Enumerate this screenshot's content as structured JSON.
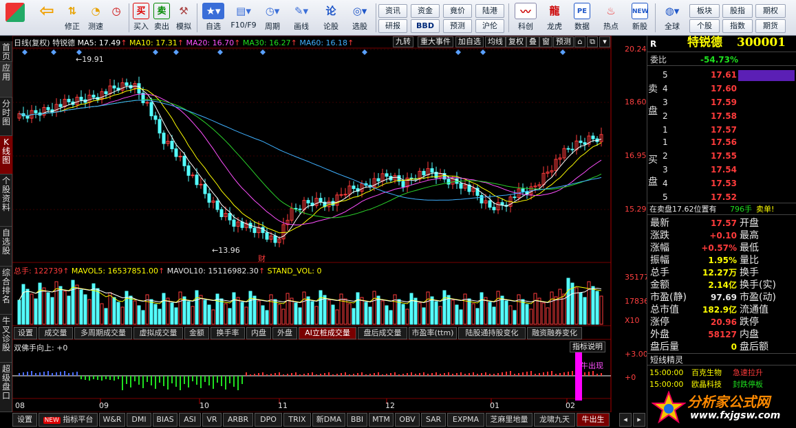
{
  "colors": {
    "up": "#ff3b3b",
    "down": "#54ffff",
    "ma5": "#ffffff",
    "ma10": "#ffff00",
    "ma20": "#ff50ff",
    "ma30": "#2bd42b",
    "ma60": "#3fb0ff"
  },
  "toolbar": {
    "main": [
      {
        "icon": "home-icon",
        "label": ""
      },
      {
        "icon": "back-arrow-icon",
        "label": ""
      },
      {
        "icon": "updown-icon",
        "label": "修正"
      },
      {
        "icon": "clock-icon",
        "label": "测速"
      },
      {
        "icon": "buy-icon",
        "label": "买入"
      },
      {
        "icon": "sell-icon",
        "label": "卖出"
      },
      {
        "icon": "hammer-icon",
        "label": "模拟"
      },
      {
        "icon": "star-icon",
        "label": "自选"
      },
      {
        "icon": "grid-icon",
        "label": "F10/F9"
      },
      {
        "icon": "period-icon",
        "label": "周期"
      },
      {
        "icon": "pen-icon",
        "label": "画线"
      },
      {
        "icon": "forum-icon",
        "label": "论股"
      },
      {
        "icon": "select-icon",
        "label": "选股"
      }
    ],
    "pills": [
      "资讯",
      "资金",
      "竟价",
      "陆港",
      "研报",
      "BBD",
      "预测",
      "沪伦"
    ],
    "main2": [
      {
        "icon": "chart-icon",
        "label": "科创"
      },
      {
        "icon": "dragon-icon",
        "label": "龙虎"
      },
      {
        "icon": "pe-icon",
        "label": "数据"
      },
      {
        "icon": "fire-icon",
        "label": "热点"
      },
      {
        "icon": "new-icon",
        "label": "新股"
      },
      {
        "icon": "globe-icon",
        "label": "全球"
      }
    ],
    "pills2": [
      "板块",
      "股指",
      "期权",
      "个股",
      "指数",
      "期货"
    ]
  },
  "left_tabs": [
    "首页",
    "应用",
    "分时图",
    "K线图",
    "个股资料",
    "自选股",
    "综合排名",
    "牛叉诊股",
    "超级盘口"
  ],
  "chart": {
    "header": {
      "title": "日线(复权)",
      "stock": "特锐德",
      "ma5": "MA5: 17.49",
      "ma10": "MA10: 17.31",
      "ma20": "MA20: 16.70",
      "ma30": "MA30: 16.27",
      "ma60": "MA60: 16.18"
    },
    "tools": [
      "九转",
      "重大事件",
      "加自选",
      "均线",
      "复权",
      "叠",
      "窗",
      "预测"
    ],
    "price_labels": [
      "20.24",
      "18.60",
      "16.95",
      "15.29"
    ],
    "high_label": "19.91",
    "low_label": "13.96",
    "event_marker": "财",
    "vol": {
      "total": "总手: 122739",
      "mavol5": "MAVOL5: 16537851.00",
      "mavol10": "MAVOL10: 15116982.30",
      "stand": "STAND_VOL: 0",
      "labels": [
        "35177",
        "17836",
        "X10"
      ]
    },
    "sub_tabs": [
      "设置",
      "成交量",
      "多周期成交量",
      "虚拟成交量",
      "金额",
      "换手率",
      "内盘",
      "外盘",
      "AI立桩成交量",
      "盘后成交量",
      "市盈率(ttm)",
      "陆股通持股变化",
      "融资融券变化"
    ],
    "indicator": {
      "title": "双佛手向上: +0",
      "explain": "指标说明",
      "labels": [
        "+3.00",
        "+0"
      ],
      "signal": "牛出现"
    },
    "months": [
      "08",
      "09",
      "10",
      "11",
      "12",
      "01",
      "02"
    ],
    "bottom_tabs": [
      "设置",
      "指标平台",
      "W&R",
      "DMI",
      "BIAS",
      "ASI",
      "VR",
      "ARBR",
      "DPO",
      "TRIX",
      "新DMA",
      "BBI",
      "MTM",
      "OBV",
      "SAR",
      "EXPMA",
      "芝麻里地量",
      "龙啸九天",
      "牛出生"
    ],
    "new_badge": "NEW"
  },
  "quote": {
    "r_label": "R",
    "name": "特锐德",
    "code": "300001",
    "weibi": {
      "k": "委比",
      "v": "-54.73%"
    },
    "sell_label": "卖盘",
    "buy_label": "买盘",
    "sell": [
      {
        "lvl": "5",
        "p": "17.61"
      },
      {
        "lvl": "4",
        "p": "17.60"
      },
      {
        "lvl": "3",
        "p": "17.59"
      },
      {
        "lvl": "2",
        "p": "17.58"
      },
      {
        "lvl": "1",
        "p": "17.57"
      }
    ],
    "buy": [
      {
        "lvl": "1",
        "p": "17.56"
      },
      {
        "lvl": "2",
        "p": "17.55"
      },
      {
        "lvl": "3",
        "p": "17.54"
      },
      {
        "lvl": "4",
        "p": "17.53"
      },
      {
        "lvl": "5",
        "p": "17.52"
      }
    ],
    "notice": {
      "text": "在卖盘17.62位置有",
      "qty": "796手",
      "act": "卖单!"
    },
    "stats": [
      {
        "k": "最新",
        "v": "17.57",
        "c": "red",
        "k2": "开盘"
      },
      {
        "k": "涨跌",
        "v": "+0.10",
        "c": "red",
        "k2": "最高"
      },
      {
        "k": "涨幅",
        "v": "+0.57%",
        "c": "red",
        "k2": "最低"
      },
      {
        "k": "振幅",
        "v": "1.95%",
        "c": "yellow",
        "k2": "量比"
      },
      {
        "k": "总手",
        "v": "12.27万",
        "c": "yellow",
        "k2": "换手"
      },
      {
        "k": "金额",
        "v": "2.14亿",
        "c": "yellow",
        "k2": "换手(实)"
      },
      {
        "k": "市盈(静)",
        "v": "97.69",
        "c": "white",
        "k2": "市盈(动)"
      },
      {
        "k": "总市值",
        "v": "182.9亿",
        "c": "yellow",
        "k2": "流通值"
      },
      {
        "k": "涨停",
        "v": "20.96",
        "c": "red",
        "k2": "跌停"
      },
      {
        "k": "外盘",
        "v": "58127",
        "c": "red",
        "k2": "内盘"
      },
      {
        "k": "盘后量",
        "v": "0",
        "c": "yellow",
        "k2": "盘后额"
      }
    ],
    "sprite_title": "短线精灵",
    "sprite": [
      {
        "t": "15:00:00",
        "s": "百克生物",
        "e": "急速拉升"
      },
      {
        "t": "15:00:00",
        "s": "欧晶科技",
        "e": "封跌停板"
      }
    ],
    "site": "分析家公式网",
    "site_url": "www.fxjgsw.com"
  }
}
